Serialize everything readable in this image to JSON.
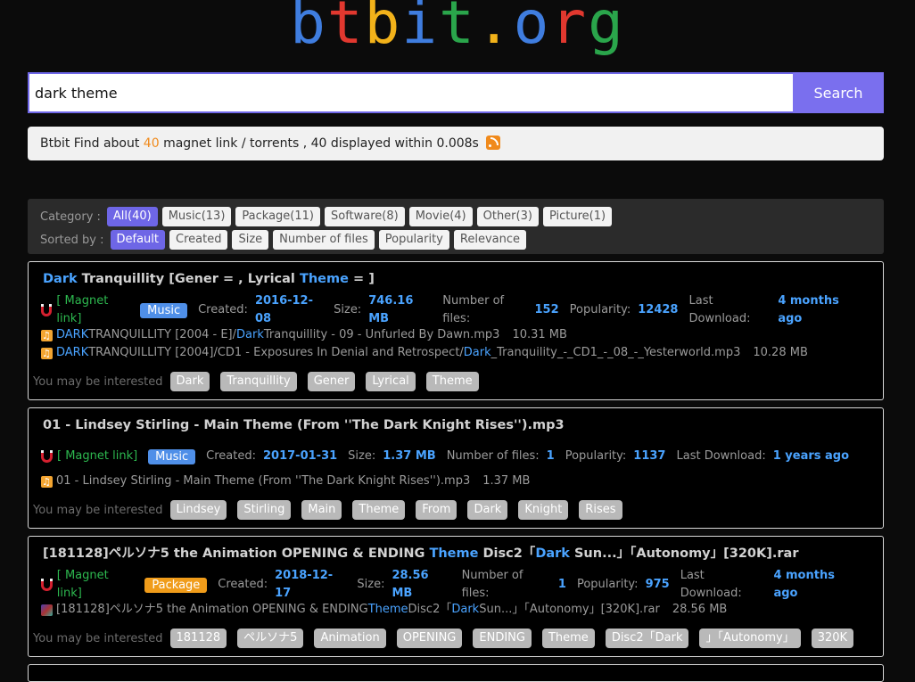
{
  "logo": {
    "letters": [
      {
        "ch": "b",
        "color": "#3f7ddf"
      },
      {
        "ch": "t",
        "color": "#e1382f"
      },
      {
        "ch": "b",
        "color": "#f2b21a"
      },
      {
        "ch": "i",
        "color": "#3f7ddf"
      },
      {
        "ch": "t",
        "color": "#2aa54b"
      },
      {
        "ch": ".",
        "color": "#f2b21a"
      },
      {
        "ch": "o",
        "color": "#3f7ddf"
      },
      {
        "ch": "r",
        "color": "#e1382f"
      },
      {
        "ch": "g",
        "color": "#2aa54b"
      }
    ]
  },
  "search": {
    "value": "dark theme",
    "button": "Search"
  },
  "stats": {
    "prefix": "Btbit Find about ",
    "count": "40",
    "suffix": " magnet link / torrents , 40 displayed within 0.008s"
  },
  "filters": {
    "category_label": "Category :",
    "categories": [
      "All(40)",
      "Music(13)",
      "Package(11)",
      "Software(8)",
      "Movie(4)",
      "Other(3)",
      "Picture(1)"
    ],
    "sort_label": "Sorted by :",
    "sorts": [
      "Default",
      "Created",
      "Size",
      "Number of files",
      "Popularity",
      "Relevance"
    ]
  },
  "labels": {
    "magnet": "[ Magnet link]",
    "created": "Created:",
    "size": "Size:",
    "files": "Number of files:",
    "popularity": "Popularity:",
    "last": "Last Download:",
    "interest": "You may be interested"
  },
  "results": [
    {
      "title": [
        {
          "t": "Dark",
          "h": true
        },
        {
          "t": " Tranquillity [Gener = , Lyrical ",
          "h": false
        },
        {
          "t": "Theme",
          "h": true
        },
        {
          "t": " = ]",
          "h": false
        }
      ],
      "type": "Music",
      "created": "2016-12-08",
      "size": "746.16 MB",
      "num_files": "152",
      "popularity": "12428",
      "last_download": "4 months ago",
      "files": [
        {
          "icon": "music",
          "parts": [
            {
              "t": "DARK",
              "h": true
            },
            {
              "t": " TRANQUILLITY [2004 - E]/",
              "h": false
            },
            {
              "t": "Dark",
              "h": true
            },
            {
              "t": " Tranquillity - 09 - Unfurled By Dawn.mp3",
              "h": false
            }
          ],
          "size": "10.31 MB"
        },
        {
          "icon": "music",
          "parts": [
            {
              "t": "DARK",
              "h": true
            },
            {
              "t": " TRANQUILLITY [2004]/CD1 - Exposures In Denial and Retrospect/",
              "h": false
            },
            {
              "t": "Dark",
              "h": true
            },
            {
              "t": "_Tranquility_-_CD1_-_08_-_Yesterworld.mp3",
              "h": false
            }
          ],
          "size": "10.28 MB"
        }
      ],
      "keywords": [
        "Dark",
        "Tranquillity",
        "Gener",
        "Lyrical",
        "Theme"
      ]
    },
    {
      "title": [
        {
          "t": "01 - Lindsey Stirling - Main Theme (From ''The Dark Knight Rises'').mp3",
          "h": false
        }
      ],
      "type": "Music",
      "created": "2017-01-31",
      "size": "1.37 MB",
      "num_files": "1",
      "popularity": "1137",
      "last_download": "1 years ago",
      "files": [
        {
          "icon": "music",
          "parts": [
            {
              "t": "01 - Lindsey Stirling - Main Theme (From ''The Dark Knight Rises'').mp3",
              "h": false
            }
          ],
          "size": "1.37 MB"
        }
      ],
      "keywords": [
        "Lindsey",
        "Stirling",
        "Main",
        "Theme",
        "From",
        "Dark",
        "Knight",
        "Rises"
      ]
    },
    {
      "title": [
        {
          "t": "[181128]ペルソナ5 the Animation OPENING & ENDING ",
          "h": false
        },
        {
          "t": "Theme",
          "h": true
        },
        {
          "t": " Disc2「",
          "h": false
        },
        {
          "t": "Dark",
          "h": true
        },
        {
          "t": " Sun...」「Autonomy」[320K].rar",
          "h": false
        }
      ],
      "type": "Package",
      "created": "2018-12-17",
      "size": "28.56 MB",
      "num_files": "1",
      "popularity": "975",
      "last_download": "4 months ago",
      "files": [
        {
          "icon": "rar",
          "parts": [
            {
              "t": "[181128]ペルソナ5 the Animation OPENING & ENDING ",
              "h": false
            },
            {
              "t": "Theme",
              "h": true
            },
            {
              "t": " Disc2「",
              "h": false
            },
            {
              "t": "Dark",
              "h": true
            },
            {
              "t": " Sun...」「Autonomy」[320K].rar",
              "h": false
            }
          ],
          "size": "28.56 MB"
        }
      ],
      "keywords": [
        "181128",
        "ペルソナ5",
        "Animation",
        "OPENING",
        "ENDING",
        "Theme",
        "Disc2「Dark",
        "」「Autonomy」",
        "320K"
      ]
    }
  ]
}
